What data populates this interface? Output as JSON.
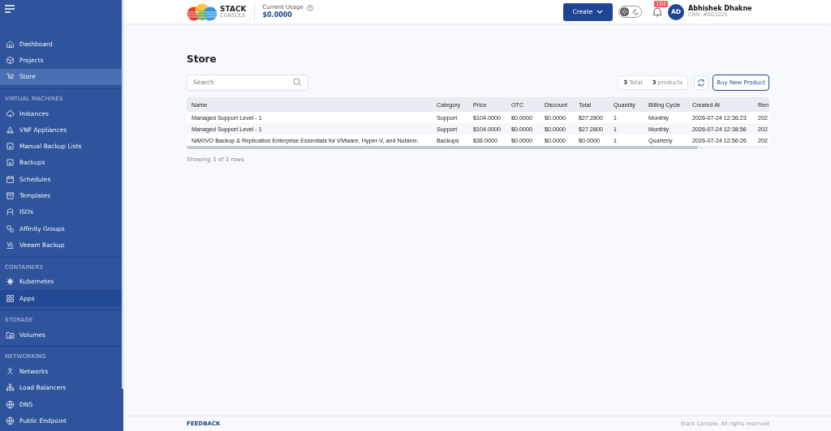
{
  "sidebar": {
    "sections": [
      {
        "items": [
          {
            "label": "Dashboard",
            "selected": false,
            "hovered": false
          },
          {
            "label": "Projects",
            "selected": false,
            "hovered": false
          },
          {
            "label": "Store",
            "selected": true,
            "hovered": false
          }
        ]
      },
      {
        "heading": "VIRTUAL MACHINES",
        "items": [
          {
            "label": "Instances",
            "selected": false,
            "hovered": false
          },
          {
            "label": "VNF Appliances",
            "selected": false,
            "hovered": false
          },
          {
            "label": "Manual Backup Lists",
            "selected": false,
            "hovered": false
          },
          {
            "label": "Backups",
            "selected": false,
            "hovered": false
          },
          {
            "label": "Schedules",
            "selected": false,
            "hovered": false
          },
          {
            "label": "Templates",
            "selected": false,
            "hovered": false
          },
          {
            "label": "ISOs",
            "selected": false,
            "hovered": false
          },
          {
            "label": "Affinity Groups",
            "selected": false,
            "hovered": false
          },
          {
            "label": "Veeam Backup",
            "selected": false,
            "hovered": false
          }
        ]
      },
      {
        "heading": "CONTAINERS",
        "items": [
          {
            "label": "Kubernetes",
            "selected": false,
            "hovered": false
          },
          {
            "label": "Apps",
            "selected": false,
            "hovered": true
          }
        ]
      },
      {
        "heading": "STORAGE",
        "items": [
          {
            "label": "Volumes",
            "selected": false,
            "hovered": false
          }
        ]
      },
      {
        "heading": "NETWORKING",
        "items": [
          {
            "label": "Networks",
            "selected": false,
            "hovered": false
          },
          {
            "label": "Load Balancers",
            "selected": false,
            "hovered": false
          },
          {
            "label": "DNS",
            "selected": false,
            "hovered": false
          },
          {
            "label": "Public Endpoint",
            "selected": false,
            "hovered": false
          }
        ]
      }
    ]
  },
  "header": {
    "logo": {
      "name": "STACK",
      "sub": "CONSOLE"
    },
    "usage": {
      "label": "Current Usage",
      "value": "$0.0000"
    },
    "create_button": "Create",
    "theme_toggle": {
      "dark_mode": false
    },
    "notifications": {
      "count": "102"
    },
    "user": {
      "initials": "AD",
      "name": "Abhishek Dhakne",
      "crn": "CRN: #001025"
    }
  },
  "page": {
    "title": "Store",
    "search": {
      "placeholder": "Search"
    },
    "counts": [
      "**3** Total",
      "**3** products"
    ],
    "buy_button": "Buy New Product"
  },
  "table": {
    "columns": [
      "Name",
      "Category",
      "Price",
      "OTC",
      "Discount",
      "Total",
      "Quantity",
      "Billing Cycle",
      "Created At",
      "Ren"
    ],
    "rows": [
      [
        "Managed Support Level - 1",
        "Support",
        "$104.0000",
        "$0.0000",
        "$0.0000",
        "$27.2800",
        "1",
        "Monthly",
        "2026-07-24 12:36:23",
        "202"
      ],
      [
        "Managed Support Level - 1",
        "Support",
        "$104.0000",
        "$0.0000",
        "$0.0000",
        "$27.2800",
        "1",
        "Monthly",
        "2026-07-24 12:38:56",
        "202"
      ],
      [
        "NAKIVO Backup & Replication Enterprise Essentials for VMware, Hyper-V, and Nutanix.",
        "Backups",
        "$36.0000",
        "$0.0000",
        "$0.0000",
        "$0.0000",
        "1",
        "Quarterly",
        "2026-07-24 12:56:26",
        "202"
      ]
    ],
    "footer": "Showing 3 of 3 rows"
  },
  "footer": {
    "link": "FEEDBACK",
    "copyright": "Stack Console. All rights reserved"
  }
}
